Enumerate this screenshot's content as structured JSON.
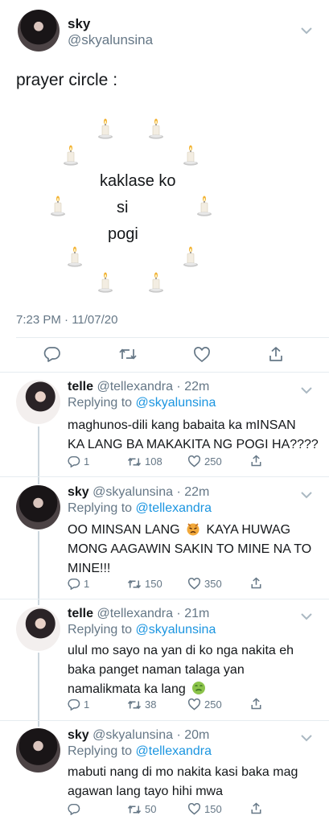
{
  "main_tweet": {
    "display_name": "sky",
    "handle": "@skyalunsina",
    "text": "prayer circle :",
    "circle_text": [
      "kaklase ko",
      "si",
      "pogi"
    ],
    "timestamp": "7:23 PM · 11/07/20"
  },
  "replies": [
    {
      "display_name": "telle",
      "handle_time": "@tellexandra · 22m",
      "replying_prefix": "Replying to",
      "replying_to": "@skyalunsina",
      "lines": [
        "maghunos-dili kang babaita ka mINSAN",
        "KA LANG BA MAKAKITA NG POGI HA????"
      ],
      "replies": "1",
      "retweets": "108",
      "likes": "250"
    },
    {
      "display_name": "sky",
      "handle_time": "@skyalunsina · 22m",
      "replying_prefix": "Replying to",
      "replying_to": "@tellexandra",
      "lines": [
        "OO MINSAN LANG",
        "KAYA HUWAG",
        "MONG AAGAWIN SAKIN TO MINE NA TO",
        "MINE!!!"
      ],
      "replies": "1",
      "retweets": "150",
      "likes": "350"
    },
    {
      "display_name": "telle",
      "handle_time": "@tellexandra · 21m",
      "replying_prefix": "Replying to",
      "replying_to": "@skyalunsina",
      "lines": [
        "ulul mo sayo na yan di ko nga nakita eh",
        "baka panget naman talaga yan",
        "namalikmata ka lang"
      ],
      "replies": "1",
      "retweets": "38",
      "likes": "250"
    },
    {
      "display_name": "sky",
      "handle_time": "@skyalunsina · 20m",
      "replying_prefix": "Replying to",
      "replying_to": "@tellexandra",
      "lines": [
        "mabuti nang di mo nakita kasi baka mag",
        "agawan lang tayo hihi mwa"
      ],
      "retweets": "50",
      "likes": "150"
    }
  ],
  "icons": [
    "chevron-down-icon",
    "candle-icon",
    "reply-icon",
    "retweet-icon",
    "like-icon",
    "share-icon",
    "angry-face-emoji",
    "nauseated-face-emoji"
  ],
  "colors": {
    "link": "#1b95e0",
    "secondary_text": "#657786",
    "divider": "#e6ecf0"
  }
}
